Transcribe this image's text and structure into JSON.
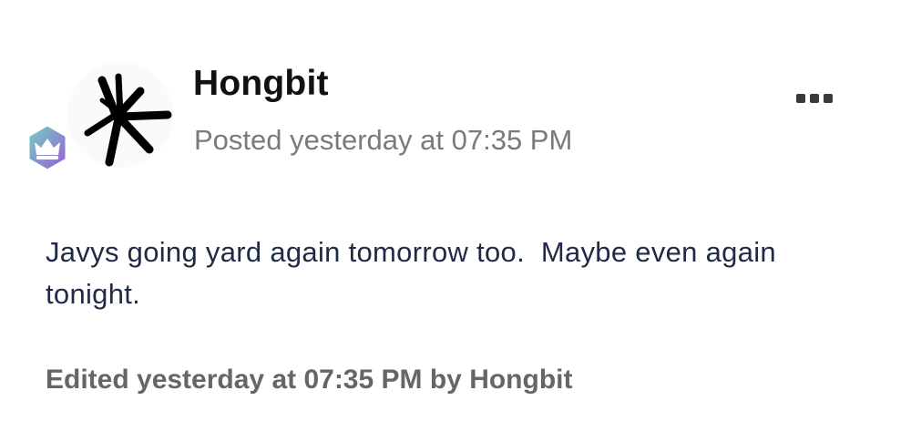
{
  "post": {
    "author": "Hongbit",
    "posted": "Posted yesterday at 07:35 PM",
    "body": "Javys going yard again tomorrow too.  Maybe even again tonight.",
    "edited": "Edited yesterday at 07:35 PM by Hongbit"
  },
  "icons": {
    "avatar": "asterisk-scribble-avatar",
    "badge": "crown-icon",
    "menu": "ellipsis-icon"
  },
  "colors": {
    "body_text": "#1f2a44",
    "meta_text": "#7a7a7a",
    "badge_gradient_start": "#6fd3c2",
    "badge_gradient_end": "#9b5bd6"
  }
}
